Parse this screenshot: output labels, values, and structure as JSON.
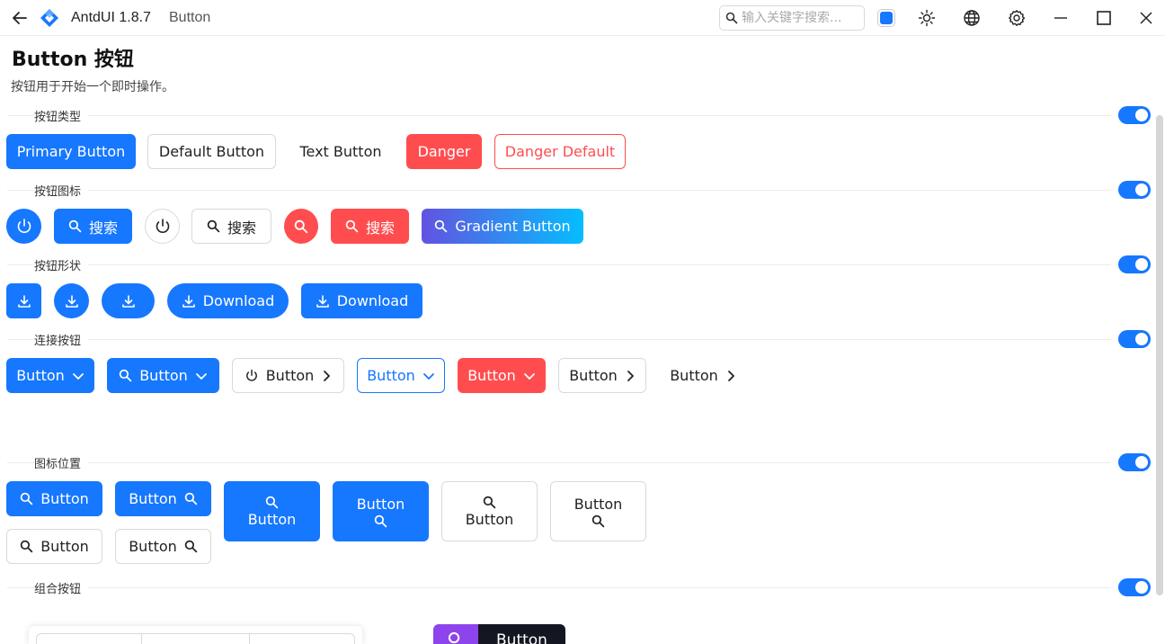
{
  "titlebar": {
    "app_name": "AntdUI 1.8.7",
    "page_name": "Button",
    "search_placeholder": "输入关键字搜索..."
  },
  "page": {
    "title": "Button 按钮",
    "description": "按钮用于开始一个即时操作。"
  },
  "accent_color": "#1677ff",
  "danger_color": "#ff4d4f",
  "sections": {
    "types": {
      "label": "按钮类型",
      "primary": "Primary Button",
      "default": "Default Button",
      "text": "Text Button",
      "danger": "Danger",
      "danger_default": "Danger Default"
    },
    "icons": {
      "label": "按钮图标",
      "search1": "搜索",
      "search2": "搜索",
      "search3": "搜索",
      "gradient": "Gradient Button"
    },
    "shapes": {
      "label": "按钮形状",
      "download1": "Download",
      "download2": "Download"
    },
    "join": {
      "label": "连接按钮",
      "b1": "Button",
      "b2": "Button",
      "b3": "Button",
      "b4": "Button",
      "b5": "Button",
      "b6": "Button",
      "b7": "Button"
    },
    "icon_position": {
      "label": "图标位置",
      "b1": "Button",
      "b2": "Button",
      "b3": "Button",
      "b4": "Button",
      "b5": "Button",
      "b6": "Button",
      "b7": "Button",
      "b8": "Button"
    },
    "group": {
      "label": "组合按钮",
      "button": "Button"
    }
  }
}
